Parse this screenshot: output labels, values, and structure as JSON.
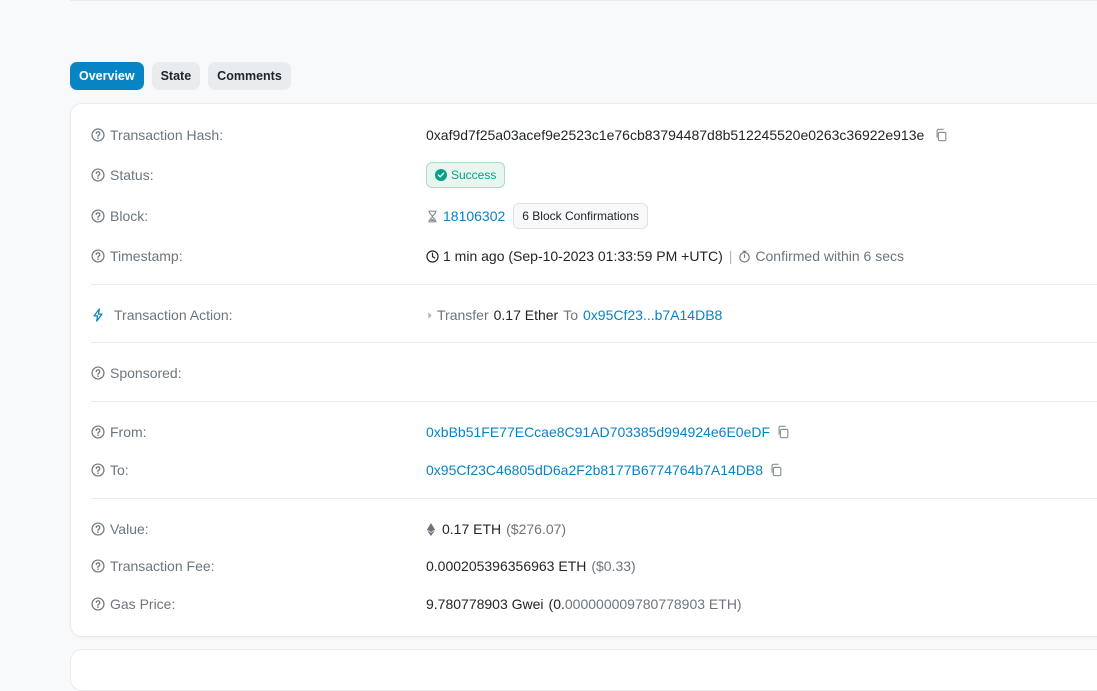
{
  "tabs": [
    {
      "label": "Overview"
    },
    {
      "label": "State"
    },
    {
      "label": "Comments"
    }
  ],
  "overview": {
    "tx_hash": {
      "label": "Transaction Hash:",
      "value": "0xaf9d7f25a03acef9e2523c1e76cb83794487d8b512245520e0263c36922e913e"
    },
    "status": {
      "label": "Status:",
      "value": "Success"
    },
    "block": {
      "label": "Block:",
      "value": "18106302",
      "confirmations": "6 Block Confirmations"
    },
    "timestamp": {
      "label": "Timestamp:",
      "value": "1 min ago (Sep-10-2023 01:33:59 PM +UTC)",
      "separator": "|",
      "confirmed": "Confirmed within 6 secs"
    },
    "action": {
      "label": "Transaction Action:",
      "verb": "Transfer",
      "amount": "0.17 Ether",
      "to_word": "To",
      "to_address": "0x95Cf23...b7A14DB8"
    },
    "sponsored": {
      "label": "Sponsored:"
    },
    "from": {
      "label": "From:",
      "value": "0xbBb51FE77ECcae8C91AD703385d994924e6E0eDF"
    },
    "to": {
      "label": "To:",
      "value": "0x95Cf23C46805dD6a2F2b8177B6774764b7A14DB8"
    },
    "value": {
      "label": "Value:",
      "amount": "0.17 ETH",
      "usd": "($276.07)"
    },
    "fee": {
      "label": "Transaction Fee:",
      "amount": "0.000205396356963 ETH",
      "usd": "($0.33)"
    },
    "gas": {
      "label": "Gas Price:",
      "gwei": "9.780778903 Gwei",
      "eth_open": "(0.",
      "eth_rest": "000000009780778903 ETH)"
    }
  },
  "colors": {
    "accent": "#0784c3",
    "success": "#00a186"
  },
  "icons": [
    "question-circle-icon",
    "copy-icon",
    "check-circle-icon",
    "hourglass-icon",
    "clock-icon",
    "stopwatch-icon",
    "lightning-icon",
    "caret-right-icon",
    "ethereum-icon"
  ]
}
